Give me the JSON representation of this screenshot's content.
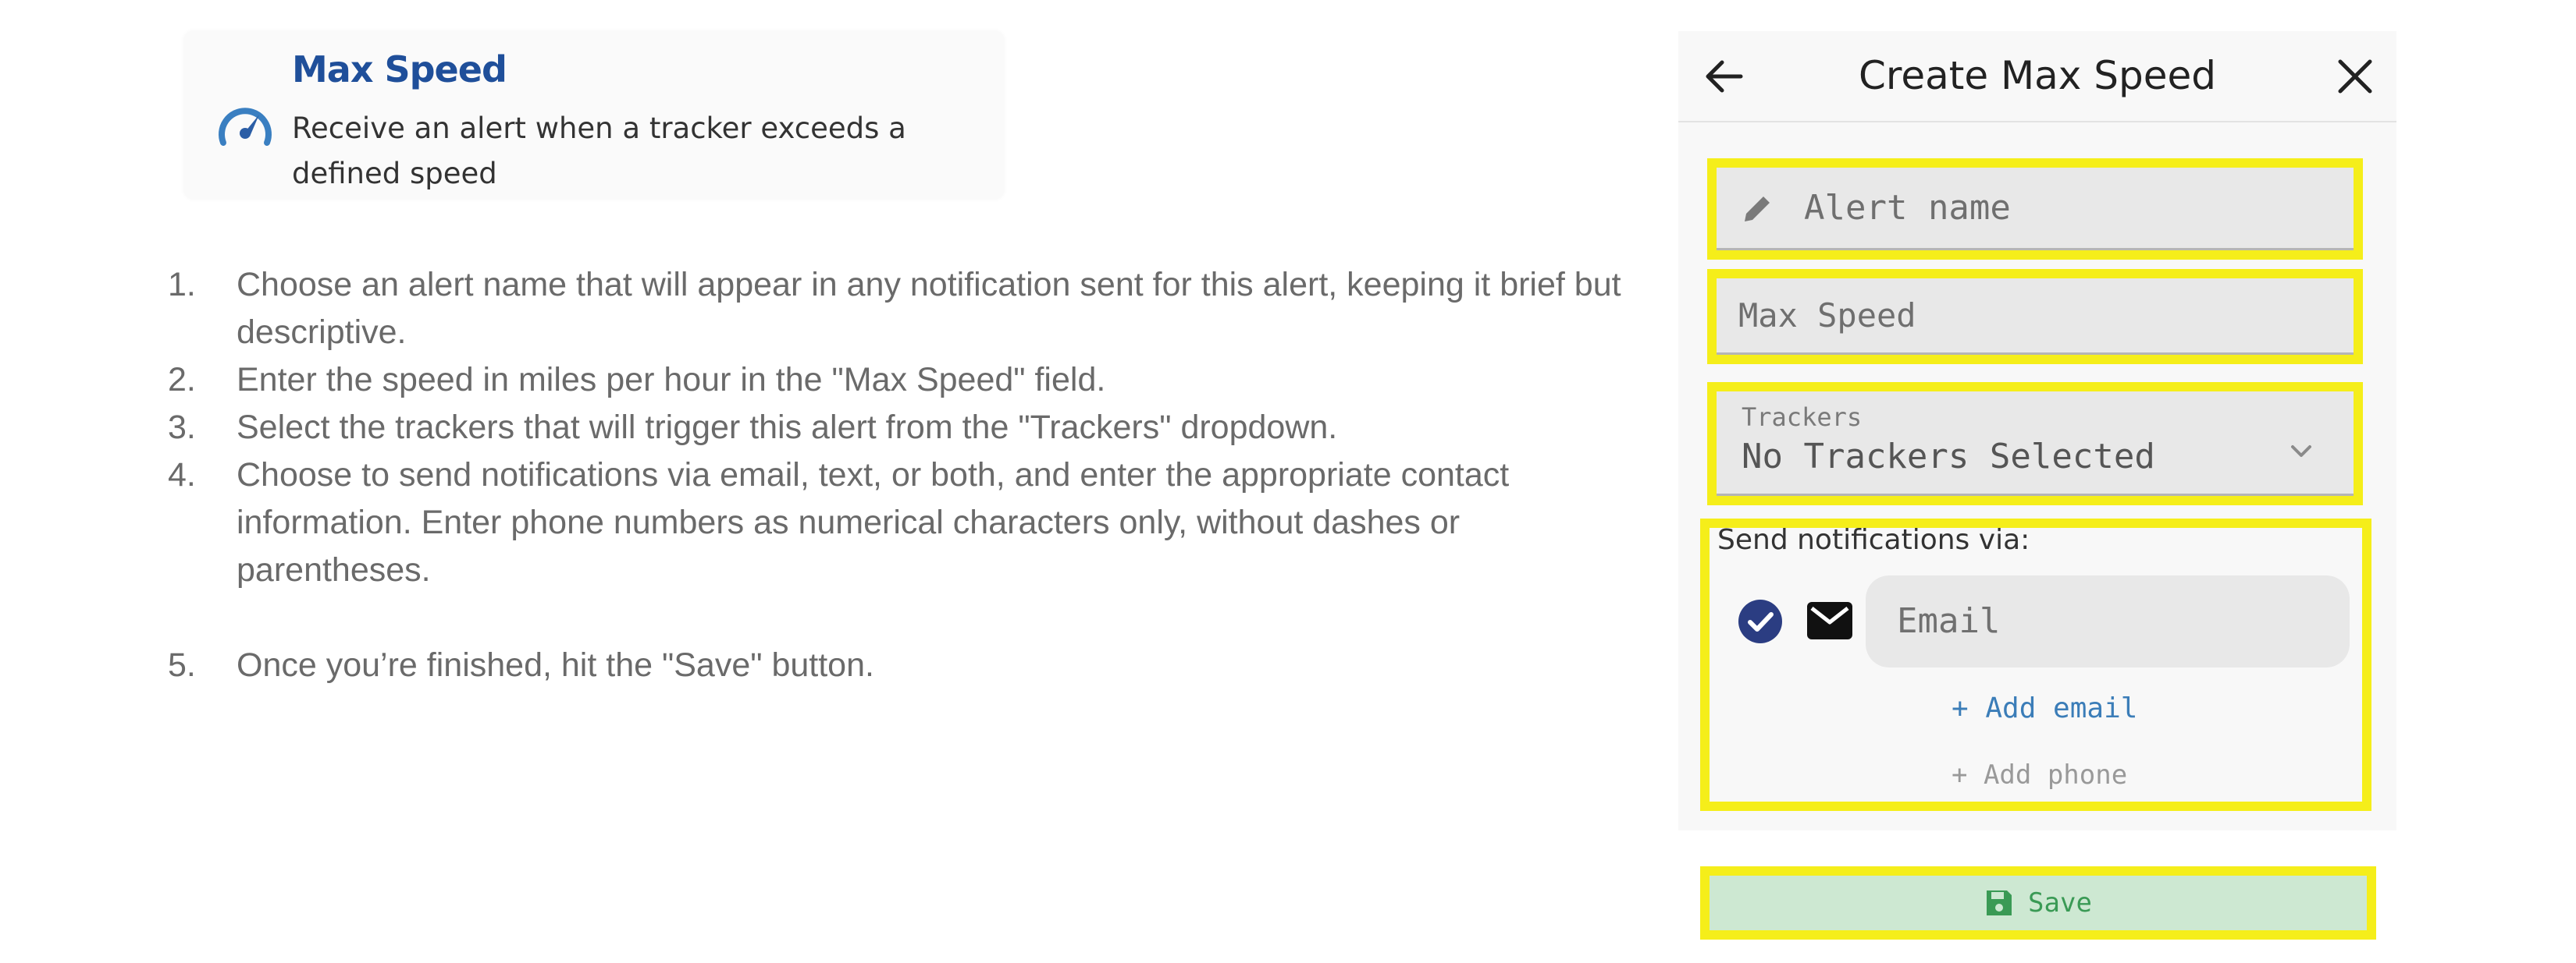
{
  "card": {
    "title": "Max Speed",
    "description": "Receive an alert when a tracker exceeds a defined speed",
    "icon": "speedometer-icon"
  },
  "steps": [
    {
      "num": "1.",
      "text": "Choose an alert name that will appear in any notification sent for this alert, keeping it brief but descriptive."
    },
    {
      "num": "2.",
      "text": "Enter the speed in miles per hour in the \"Max Speed\" field."
    },
    {
      "num": "3.",
      "text": "Select the trackers that will trigger this alert from the \"Trackers\" dropdown."
    },
    {
      "num": "4.",
      "text": "Choose to send notifications via email, text, or both, and enter the appropriate contact information. Enter phone numbers as numerical characters only, without dashes or parentheses."
    },
    {
      "num": "5.",
      "text": "Once you’re finished, hit the \"Save\" button."
    }
  ],
  "panel": {
    "title": "Create Max Speed",
    "alert_name_placeholder": "Alert name",
    "max_speed_placeholder": "Max Speed",
    "trackers_label": "Trackers",
    "trackers_value": "No Trackers Selected",
    "notify_label": "Send notifications via:",
    "email_placeholder": "Email",
    "add_email": "+ Add email",
    "add_phone": "+ Add phone",
    "save": "Save"
  },
  "colors": {
    "highlight": "#f5ee1a",
    "title_blue": "#1f4f9a",
    "link_blue": "#3b7db8",
    "save_green": "#3a9a55",
    "save_bg": "#cde8d2",
    "check_navy": "#2b3d82"
  }
}
